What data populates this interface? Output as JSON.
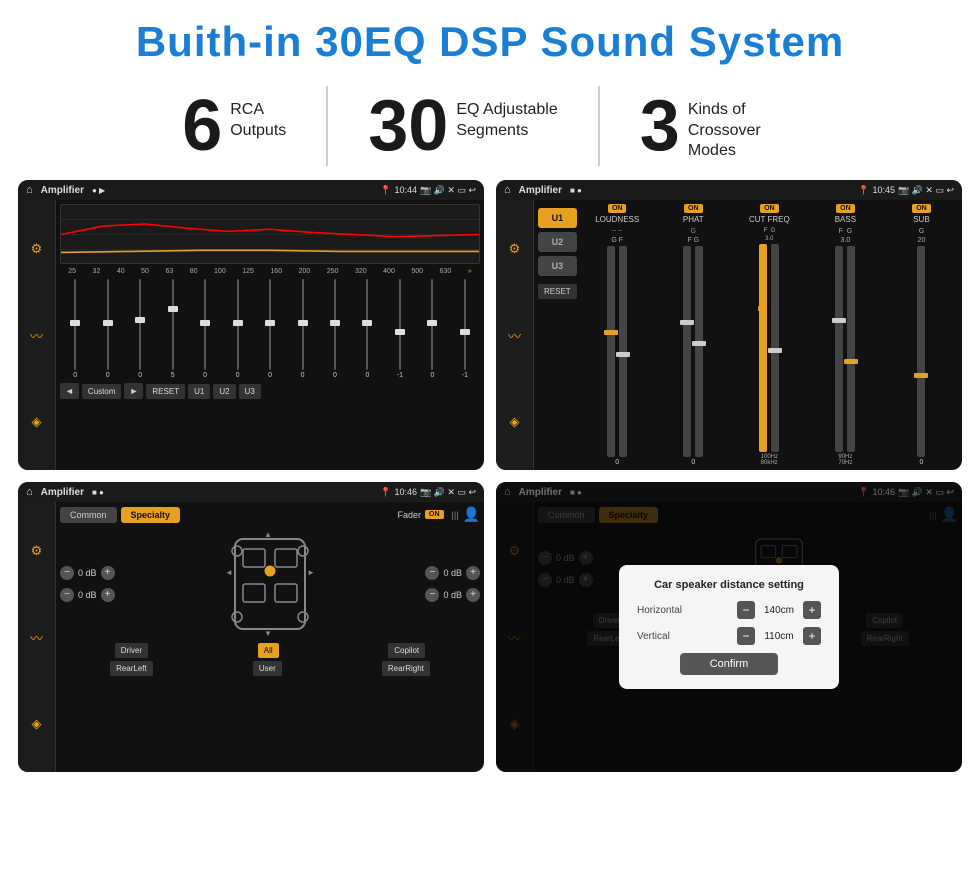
{
  "header": {
    "title": "Buith-in 30EQ DSP Sound System"
  },
  "stats": [
    {
      "number": "6",
      "label_line1": "RCA",
      "label_line2": "Outputs"
    },
    {
      "number": "30",
      "label_line1": "EQ Adjustable",
      "label_line2": "Segments"
    },
    {
      "number": "3",
      "label_line1": "Kinds of",
      "label_line2": "Crossover Modes"
    }
  ],
  "screens": [
    {
      "id": "eq-screen",
      "statusbar": {
        "app": "Amplifier",
        "time": "10:44"
      },
      "eq_labels": [
        "25",
        "32",
        "40",
        "50",
        "63",
        "80",
        "100",
        "125",
        "160",
        "200",
        "250",
        "320",
        "400",
        "500",
        "630"
      ],
      "slider_values": [
        "0",
        "0",
        "0",
        "5",
        "0",
        "0",
        "0",
        "0",
        "0",
        "0",
        "-1",
        "0",
        "-1"
      ],
      "bottom_buttons": [
        "◄",
        "Custom",
        "►",
        "RESET",
        "U1",
        "U2",
        "U3"
      ]
    },
    {
      "id": "crossover-screen",
      "statusbar": {
        "app": "Amplifier",
        "time": "10:45"
      },
      "u_buttons": [
        "U1",
        "U2",
        "U3"
      ],
      "channels": [
        {
          "name": "LOUDNESS",
          "on": true
        },
        {
          "name": "PHAT",
          "on": true
        },
        {
          "name": "CUT FREQ",
          "on": true
        },
        {
          "name": "BASS",
          "on": true
        },
        {
          "name": "SUB",
          "on": true
        }
      ],
      "reset_label": "RESET"
    },
    {
      "id": "speaker-screen",
      "statusbar": {
        "app": "Amplifier",
        "time": "10:46"
      },
      "tabs": [
        "Common",
        "Specialty"
      ],
      "fader_label": "Fader",
      "fader_on": "ON",
      "db_controls": [
        {
          "value": "0 dB"
        },
        {
          "value": "0 dB"
        },
        {
          "value": "0 dB"
        },
        {
          "value": "0 dB"
        }
      ],
      "bottom_labels": [
        "Driver",
        "",
        "Copilot",
        "RearLeft",
        "All",
        "User",
        "RearRight"
      ]
    },
    {
      "id": "dialog-screen",
      "statusbar": {
        "app": "Amplifier",
        "time": "10:46"
      },
      "tabs": [
        "Common",
        "Specialty"
      ],
      "dialog": {
        "title": "Car speaker distance setting",
        "horizontal_label": "Horizontal",
        "horizontal_value": "140cm",
        "vertical_label": "Vertical",
        "vertical_value": "110cm",
        "confirm_label": "Confirm"
      },
      "db_controls": [
        {
          "value": "0 dB"
        },
        {
          "value": "0 dB"
        }
      ],
      "bottom_labels": [
        "Driver",
        "",
        "Copilot",
        "RearLef...",
        "All",
        "User",
        "RearRight"
      ]
    }
  ]
}
